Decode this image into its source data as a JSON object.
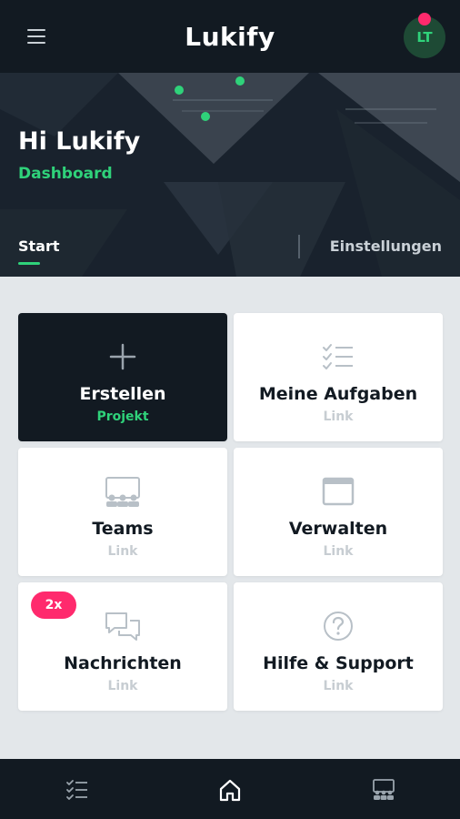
{
  "header": {
    "app_title": "Lukify",
    "avatar_initials": "LT",
    "menu_icon": "hamburger-icon"
  },
  "hero": {
    "greeting": "Hi Lukify",
    "subtitle": "Dashboard"
  },
  "tabs": {
    "start": "Start",
    "settings": "Einstellungen"
  },
  "tiles": [
    {
      "title": "Erstellen",
      "sub": "Projekt",
      "icon": "plus-icon"
    },
    {
      "title": "Meine Aufgaben",
      "sub": "Link",
      "icon": "checklist-icon"
    },
    {
      "title": "Teams",
      "sub": "Link",
      "icon": "team-icon"
    },
    {
      "title": "Verwalten",
      "sub": "Link",
      "icon": "window-icon"
    },
    {
      "title": "Nachrichten",
      "sub": "Link",
      "icon": "chat-icon",
      "badge": "2x"
    },
    {
      "title": "Hilfe & Support",
      "sub": "Link",
      "icon": "help-icon"
    }
  ],
  "bottom_nav": [
    {
      "icon": "checklist-icon"
    },
    {
      "icon": "home-icon"
    },
    {
      "icon": "team-icon"
    }
  ],
  "colors": {
    "dark": "#121a22",
    "accent": "#2fd27a",
    "badge": "#ff2a6d",
    "background": "#e3e7ea"
  }
}
